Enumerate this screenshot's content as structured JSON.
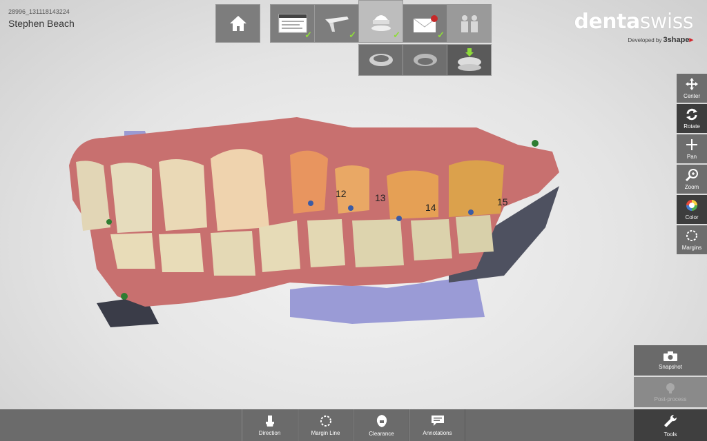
{
  "case": {
    "id": "28996_131118143224",
    "patient_name": "Stephen Beach"
  },
  "logo": {
    "denta": "denta",
    "swiss": "swiss",
    "developed_by": "Developed by",
    "brand_3": "3",
    "brand_shape": "shape"
  },
  "workflow": {
    "home": {
      "icon": "home-icon"
    },
    "steps": [
      {
        "icon": "order-form-icon",
        "checked": true
      },
      {
        "icon": "scanner-icon",
        "checked": true
      },
      {
        "icon": "scan-model-icon",
        "checked": true,
        "active": true
      },
      {
        "icon": "send-envelope-icon",
        "checked": true
      },
      {
        "icon": "collaboration-icon",
        "checked": false
      }
    ],
    "substeps": [
      {
        "icon": "upper-jaw-icon"
      },
      {
        "icon": "lower-jaw-icon"
      },
      {
        "icon": "bite-scan-icon",
        "active": true
      }
    ]
  },
  "right_tools": [
    {
      "label": "Center",
      "icon": "center-icon"
    },
    {
      "label": "Rotate",
      "icon": "rotate-icon",
      "active": true
    },
    {
      "label": "Pan",
      "icon": "pan-icon"
    },
    {
      "label": "Zoom",
      "icon": "zoom-icon"
    },
    {
      "label": "Color",
      "icon": "color-icon",
      "active": true
    },
    {
      "label": "Margins",
      "icon": "margins-icon"
    }
  ],
  "side_actions": [
    {
      "label": "Snapshot",
      "icon": "camera-icon"
    },
    {
      "label": "Post-process",
      "icon": "post-process-icon",
      "disabled": true
    }
  ],
  "bottom_tools": [
    {
      "label": "Direction",
      "icon": "direction-icon"
    },
    {
      "label": "Margin Line",
      "icon": "margin-line-icon"
    },
    {
      "label": "Clearance",
      "icon": "clearance-icon"
    },
    {
      "label": "Annotations",
      "icon": "annotations-icon"
    }
  ],
  "tools_button": {
    "label": "Tools",
    "icon": "wrench-icon"
  },
  "tooth_labels": [
    "12",
    "13",
    "14",
    "15"
  ],
  "colors": {
    "toolbar": "#6b6b6b",
    "active": "#3f3f3f",
    "check": "#8fdc3a",
    "gum": "#c8706f",
    "tooth": "#e8dcb8"
  }
}
